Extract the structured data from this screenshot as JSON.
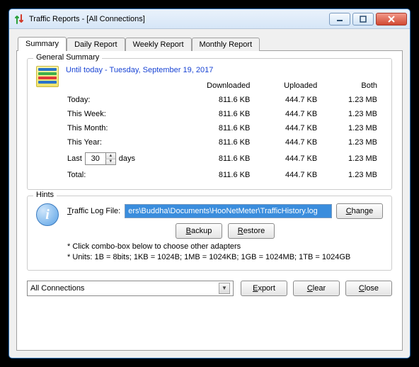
{
  "window": {
    "title": "Traffic Reports - [All Connections]"
  },
  "tabs": {
    "summary": "Summary",
    "daily": "Daily Report",
    "weekly": "Weekly Report",
    "monthly": "Monthly Report"
  },
  "summary": {
    "legend": "General Summary",
    "date_line": "Until today - Tuesday, September 19, 2017",
    "cols": {
      "c1": "Downloaded",
      "c2": "Uploaded",
      "c3": "Both"
    },
    "rows": {
      "today": {
        "label": "Today:",
        "dl": "811.6 KB",
        "ul": "444.7 KB",
        "both": "1.23 MB"
      },
      "week": {
        "label": "This Week:",
        "dl": "811.6 KB",
        "ul": "444.7 KB",
        "both": "1.23 MB"
      },
      "month": {
        "label": "This Month:",
        "dl": "811.6 KB",
        "ul": "444.7 KB",
        "both": "1.23 MB"
      },
      "year": {
        "label": "This Year:",
        "dl": "811.6 KB",
        "ul": "444.7 KB",
        "both": "1.23 MB"
      },
      "lastn": {
        "prefix": "Last",
        "value": "30",
        "suffix": "days",
        "dl": "811.6 KB",
        "ul": "444.7 KB",
        "both": "1.23 MB"
      },
      "total": {
        "label": "Total:",
        "dl": "811.6 KB",
        "ul": "444.7 KB",
        "both": "1.23 MB"
      }
    }
  },
  "hints": {
    "legend": "Hints",
    "log_label_pre": "T",
    "log_label_post": "raffic Log File:",
    "log_value": "ers\\Buddha\\Documents\\HooNetMeter\\TrafficHistory.log",
    "change_pre": "C",
    "change_post": "hange",
    "backup_pre": "B",
    "backup_post": "ackup",
    "restore_pre": "R",
    "restore_post": "estore",
    "line1": "* Click combo-box below to choose other adapters",
    "line2": "* Units: 1B = 8bits; 1KB = 1024B; 1MB = 1024KB; 1GB = 1024MB; 1TB = 1024GB"
  },
  "footer": {
    "combo_value": "All Connections",
    "export_pre": "E",
    "export_post": "xport",
    "clear_pre": "C",
    "clear_post": "lear",
    "close_pre": "C",
    "close_post": "lose"
  }
}
